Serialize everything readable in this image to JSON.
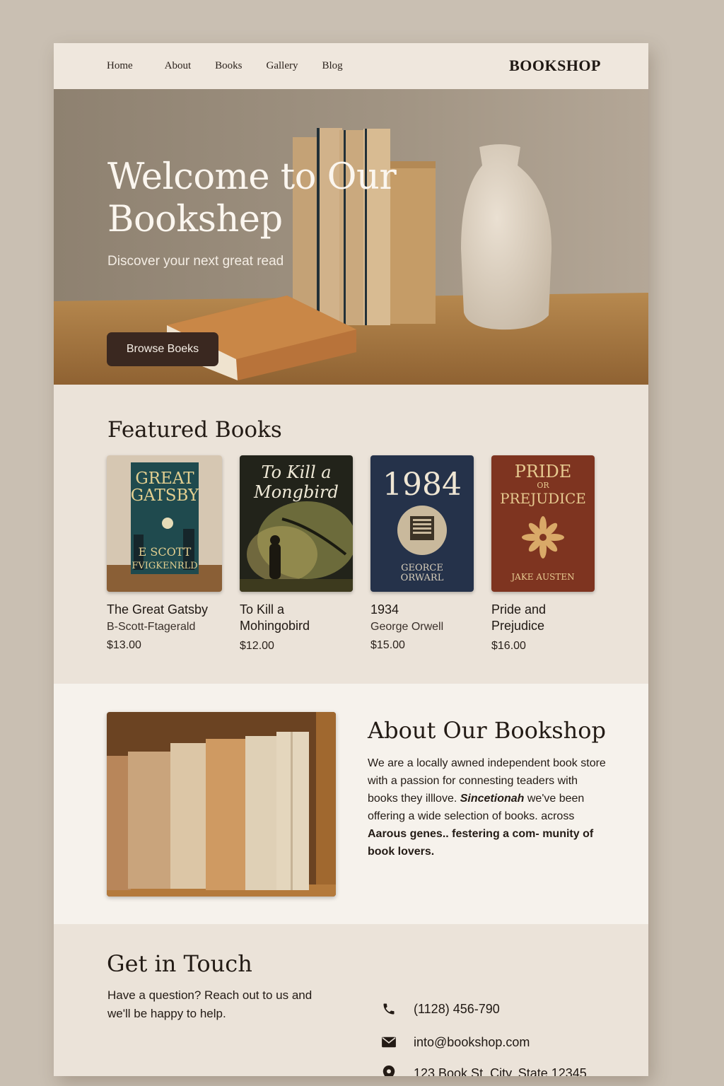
{
  "nav": {
    "links": [
      "Home",
      "About",
      "Books",
      "Gallery",
      "Blog"
    ],
    "brand": "BOOKSHOP"
  },
  "hero": {
    "title": "Welcome to Our Bookshep",
    "subtitle": "Discover your next great read",
    "button": "Browse Boeks"
  },
  "featured": {
    "heading": "Featured Books",
    "books": [
      {
        "title": "The Great Gatsby",
        "author": "B-Scott-Ftagerald",
        "price": "$13.00",
        "cover_text": [
          "GREAT",
          "GATSBY",
          "E SCOTT",
          "FVIGKENRLD"
        ],
        "cover_color": "#1f4a4e"
      },
      {
        "title": "To Kill a Mohingobird",
        "author": "",
        "price": "$12.00",
        "cover_text": [
          "To Kill a",
          "Mongbird"
        ],
        "cover_color": "#2a2a1a"
      },
      {
        "title": "1934",
        "author": "George Orwell",
        "price": "$15.00",
        "cover_text": [
          "1984",
          "GEORCE",
          "ORWARL"
        ],
        "cover_color": "#25324a"
      },
      {
        "title": "Pride and Prejudice",
        "author": "",
        "price": "$16.00",
        "cover_text": [
          "PRIDE",
          "OR",
          "PREJUDICE",
          "JAKE AUSTEN"
        ],
        "cover_color": "#7e3420"
      }
    ]
  },
  "about": {
    "heading": "About Our Bookshop",
    "text_a": "We are a locally awned independent book store with a passion for connesting teaders with books they illlove. ",
    "text_em": "Sincetionah",
    "text_b": " we've been offering a wide selection of books. across ",
    "text_c": "Aarous genes.. festering a com-",
    "text_d": "munity of book lovers."
  },
  "contact": {
    "heading": "Get in Touch",
    "text": "Have a question? Reach out to us and we'll be happy to help.",
    "phone": "(1128) 456-790",
    "email": "into@bookshop.com",
    "address": "123 Book St. City, State 12345",
    "icons": [
      "phone-icon",
      "mail-icon",
      "location-pin-icon"
    ]
  },
  "colors": {
    "page_bg": "#c9bfb2",
    "button": "#3a2820",
    "cream": "#ece4da"
  }
}
